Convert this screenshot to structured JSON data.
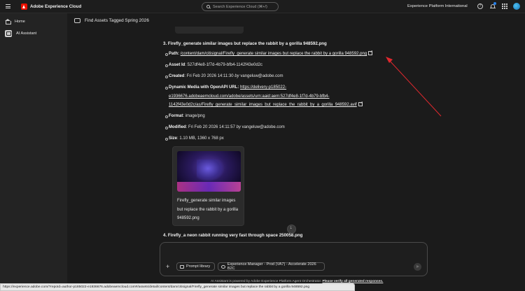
{
  "header": {
    "brand": "Adobe Experience Cloud",
    "search_placeholder": "Search Experience Cloud (⌘+/)",
    "org": "Experience Platform International"
  },
  "sidebar": {
    "items": [
      {
        "label": "Home",
        "icon": "home-icon"
      },
      {
        "label": "AI Assistant",
        "icon": "ai-assistant-icon"
      }
    ]
  },
  "conversation": {
    "title": "Find Assets Tagged Spring 2026",
    "item3": {
      "heading": "3. Firefly_generate similar images but replace the rabbit by a gorilla 948592.png",
      "path_label": "Path",
      "path_value": "/content/dam/citisignal/Firefly_generate similar images but replace the rabbit by a gorilla 948592.png",
      "asset_id_label": "Asset Id",
      "asset_id_value": ": 527df4e8-1f7d-4b79-bfb4-1142f43e0d2c",
      "created_label": "Created",
      "created_value": ": Fri Feb 20 2026 14:11:30",
      "created_by_word": "by",
      "created_by": "vangeluw@adobe.com",
      "dm_label": "Dynamic Media with OpenAPI URL",
      "dm_line1": "https://delivery-p185022-",
      "dm_line2": "e1936676.adobeaemcloud.com/adobe/assets/urn:aaid:aem:527df4e8-1f7d-4b79-bfb4-",
      "dm_line3": "1142f43e0d2c/as/Firefly_generate_similar_images_but_replace_the_rabbit_by_a_gorilla_948592.avif",
      "format_label": "Format",
      "format_value": ": image/png",
      "modified_label": "Modified",
      "modified_value": ": Fri Feb 20 2026 14:11:57",
      "modified_by_word": "by",
      "modified_by": "vangeluw@adobe.com",
      "size_label": "Size",
      "size_value": ": 1.10 MB, 1360 x 768 px",
      "thumb_caption": "Firefly_generate similar images but replace the rabbit by a gorilla 948592.png"
    },
    "item4_heading": "4. Firefly_a neon rabbit running very fast through space 250058.png"
  },
  "composer": {
    "prompt_library": "Prompt library",
    "context": "Experience Manager - Prod (VA7) - Accelerate 2026 B2C"
  },
  "disclaimer": {
    "text": "AI Assistant is powered by Adobe Experience Platform Agent Orchestrator.",
    "verify": "Please verify all generated responses."
  },
  "status_url": "https://experience.adobe.com/?repoId=author-p185022-e1936676.adobeaemcloud.com#/assets/detail/content/dam/citisignal/Firefly_generate similar images but replace the rabbit by a gorilla 948592.png",
  "colors": {
    "adobe_red": "#eb1000",
    "notification": "#2680eb",
    "annotation_arrow": "#e0282e"
  }
}
